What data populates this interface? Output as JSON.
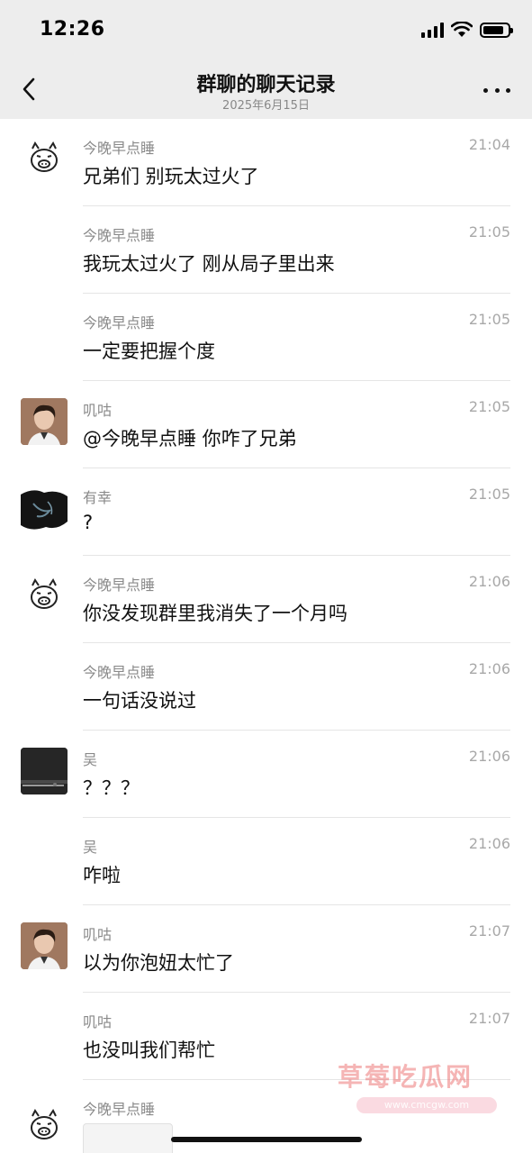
{
  "status_bar": {
    "time": "12:26",
    "signal_icon": "signal-icon",
    "wifi_icon": "wifi-icon",
    "battery_icon": "battery-icon"
  },
  "nav": {
    "title": "群聊的聊天记录",
    "subtitle": "2025年6月15日",
    "back_icon": "chevron-left-icon",
    "more_icon": "more-dots-icon"
  },
  "messages": [
    {
      "sender": "今晚早点睡",
      "time": "21:04",
      "text": "兄弟们 别玩太过火了",
      "avatar": "pig-avatar"
    },
    {
      "sender": "今晚早点睡",
      "time": "21:05",
      "text": "我玩太过火了 刚从局子里出来",
      "avatar": ""
    },
    {
      "sender": "今晚早点睡",
      "time": "21:05",
      "text": "一定要把握个度",
      "avatar": ""
    },
    {
      "sender": "叽咕",
      "time": "21:05",
      "text": "@今晚早点睡 你咋了兄弟",
      "avatar": "person-photo-avatar"
    },
    {
      "sender": "有幸",
      "time": "21:05",
      "text": "?",
      "avatar": "dark-art-avatar"
    },
    {
      "sender": "今晚早点睡",
      "time": "21:06",
      "text": "你没发现群里我消失了一个月吗",
      "avatar": "pig-avatar"
    },
    {
      "sender": "今晚早点睡",
      "time": "21:06",
      "text": "一句话没说过",
      "avatar": ""
    },
    {
      "sender": "吴",
      "time": "21:06",
      "text": "？？？",
      "avatar": "dark-device-avatar"
    },
    {
      "sender": "吴",
      "time": "21:06",
      "text": "咋啦",
      "avatar": ""
    },
    {
      "sender": "叽咕",
      "time": "21:07",
      "text": "以为你泡妞太忙了",
      "avatar": "person-photo-avatar"
    },
    {
      "sender": "叽咕",
      "time": "21:07",
      "text": "也没叫我们帮忙",
      "avatar": ""
    },
    {
      "sender": "今晚早点睡",
      "time": "",
      "text": "",
      "avatar": "pig-avatar",
      "attachment": "screenshot-thumbnail"
    }
  ],
  "watermark": {
    "text": "草莓吃瓜网",
    "url": "www.cmcgw.com"
  },
  "colors": {
    "header_bg": "#ededed",
    "sender_gray": "#8a8a8a",
    "time_gray": "#a8a8a8",
    "divider": "#e5e5e5",
    "watermark": "#ec7878"
  }
}
